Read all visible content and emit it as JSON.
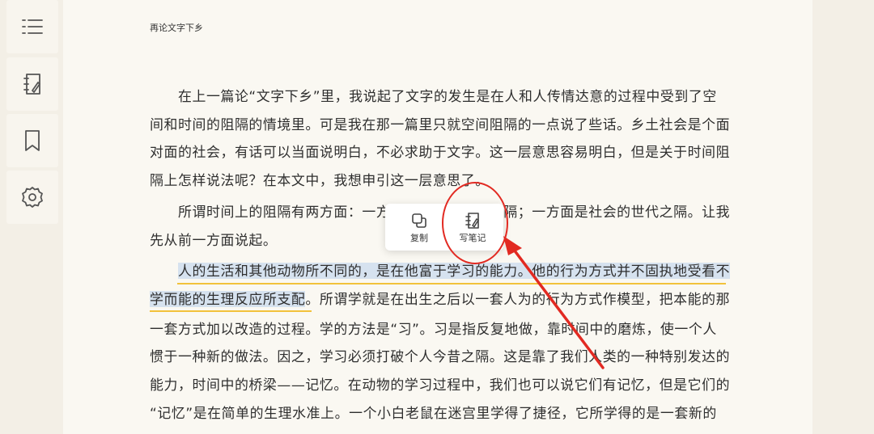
{
  "sidebar": {
    "items": [
      {
        "icon": "list-icon"
      },
      {
        "icon": "notes-icon"
      },
      {
        "icon": "bookmark-icon"
      },
      {
        "icon": "gear-icon"
      }
    ]
  },
  "reader": {
    "chapter_title": "再论文字下乡",
    "lines": [
      "　　在上一篇论“文字下乡”里，我说起了文字的发生是在人和人传情达意的过程中受到了空",
      "间和时间的阻隔的情境里。可是我在那一篇里只就空间阻隔的一点说了些话。乡土社会是个面",
      "对面的社会，有话可以当面说明白，不必求助于文字。这一层意思容易明白，但是关于时间阻",
      "隔上怎样说法呢？在本文中，我想申引这一层意思了。",
      "　　所谓时间上的阻隔有两方面：一方面是个人的今昔之隔；一方面是社会的世代之隔。让我",
      "先从前一方面说起。",
      "",
      "",
      "一套方式加以改造的过程。学的方法是“习”。习是指反复地做，靠时间中的磨炼，使一个人",
      "惯于一种新的做法。因之，学习必须打破个人今昔之隔。这是靠了我们人类的一种特别发达的",
      "能力，时间中的桥梁——记忆。在动物的学习过程中，我们也可以说它们有记忆，但是它们的",
      "“记忆”是在简单的生理水准上。一个小白老鼠在迷宫里学得了捷径，它所学得的是一套新的"
    ],
    "highlight_line1": {
      "indent": "　　",
      "highlighted": "人的生活和其他动物所不同的，是在他富于学习的能力。他的行为方式并不固执地受看不"
    },
    "highlight_line2": {
      "highlighted": "学而能的生理反应所支配",
      "rest": "。所谓学就是在出生之后以一套人为的行为方式作模型，把本能的那"
    }
  },
  "popup": {
    "copy_label": "复制",
    "copy_icon": "copy-icon",
    "note_label": "写笔记",
    "note_icon": "write-note-icon"
  },
  "colors": {
    "highlight": "#d6e2ef",
    "underline": "#f2c23b",
    "annotation": "#e22a22"
  }
}
